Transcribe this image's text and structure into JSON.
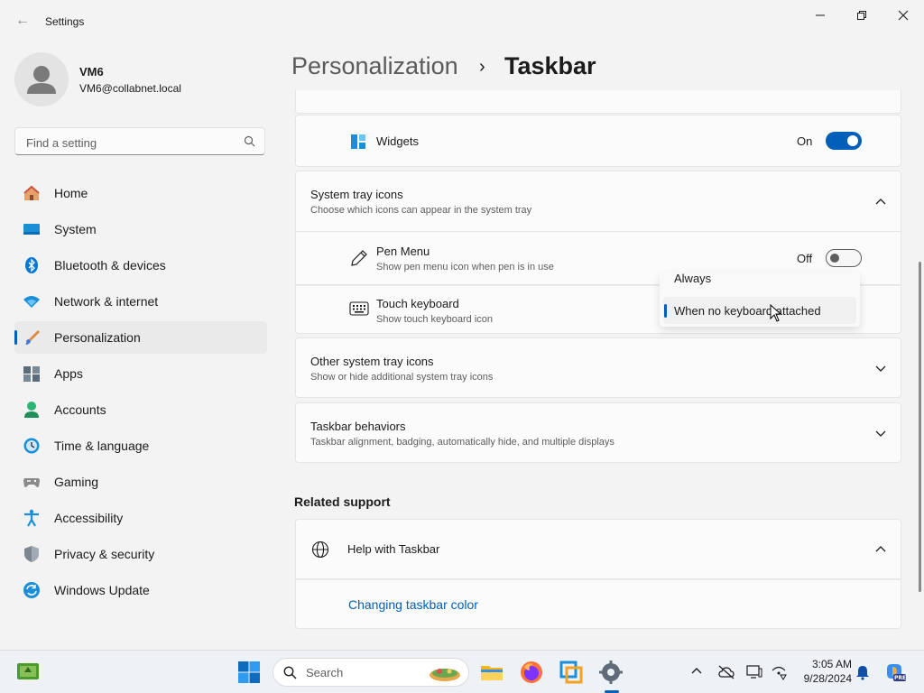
{
  "window": {
    "title": "Settings",
    "back_label": "←"
  },
  "user": {
    "name": "VM6",
    "email": "VM6@collabnet.local"
  },
  "search": {
    "placeholder": "Find a setting"
  },
  "sidebar": {
    "items": [
      {
        "label": "Home",
        "icon": "home-icon"
      },
      {
        "label": "System",
        "icon": "system-icon"
      },
      {
        "label": "Bluetooth & devices",
        "icon": "bluetooth-icon"
      },
      {
        "label": "Network & internet",
        "icon": "network-icon"
      },
      {
        "label": "Personalization",
        "icon": "brush-icon",
        "selected": true
      },
      {
        "label": "Apps",
        "icon": "apps-icon"
      },
      {
        "label": "Accounts",
        "icon": "accounts-icon"
      },
      {
        "label": "Time & language",
        "icon": "clock-icon"
      },
      {
        "label": "Gaming",
        "icon": "gamepad-icon"
      },
      {
        "label": "Accessibility",
        "icon": "accessibility-icon"
      },
      {
        "label": "Privacy & security",
        "icon": "shield-icon"
      },
      {
        "label": "Windows Update",
        "icon": "update-icon"
      }
    ]
  },
  "breadcrumb": {
    "parent": "Personalization",
    "separator": "›",
    "current": "Taskbar"
  },
  "widgets": {
    "label": "Widgets",
    "state_label": "On",
    "on": true
  },
  "system_tray": {
    "title": "System tray icons",
    "subtitle": "Choose which icons can appear in the system tray",
    "pen_menu": {
      "title": "Pen Menu",
      "subtitle": "Show pen menu icon when pen is in use",
      "state_label": "Off",
      "on": false
    },
    "touch_keyboard": {
      "title": "Touch keyboard",
      "subtitle": "Show touch keyboard icon",
      "dropdown_options": [
        "Always",
        "When no keyboard attached"
      ],
      "selected": "When no keyboard attached"
    }
  },
  "other_tray": {
    "title": "Other system tray icons",
    "subtitle": "Show or hide additional system tray icons"
  },
  "behaviors": {
    "title": "Taskbar behaviors",
    "subtitle": "Taskbar alignment, badging, automatically hide, and multiple displays"
  },
  "related": {
    "heading": "Related support",
    "help_title": "Help with Taskbar",
    "link": "Changing taskbar color"
  },
  "taskbar": {
    "search_label": "Search",
    "time": "3:05 AM",
    "date": "9/28/2024",
    "copilot_badge": "PRE"
  },
  "colors": {
    "accent": "#005fb8",
    "background": "#f3f3f3",
    "card": "#fbfbfb"
  }
}
